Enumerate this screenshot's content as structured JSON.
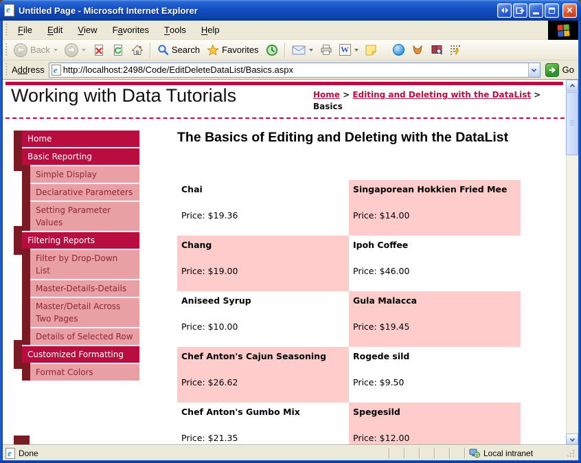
{
  "window": {
    "title": "Untitled Page - Microsoft Internet Explorer"
  },
  "menu": {
    "items": [
      {
        "label": "File",
        "accel": 0
      },
      {
        "label": "Edit",
        "accel": 0
      },
      {
        "label": "View",
        "accel": 0
      },
      {
        "label": "Favorites",
        "accel": 1
      },
      {
        "label": "Tools",
        "accel": 0
      },
      {
        "label": "Help",
        "accel": 0
      }
    ]
  },
  "toolbar": {
    "back_label": "Back",
    "search_label": "Search",
    "favorites_label": "Favorites"
  },
  "address": {
    "label_pre": "A",
    "label_accel": "dd",
    "label_rest": "ress",
    "url": "http://localhost:2498/Code/EditDeleteDataList/Basics.aspx",
    "go_label": "Go"
  },
  "page": {
    "site_title": "Working with Data Tutorials",
    "breadcrumb": {
      "separator": ">",
      "items": [
        {
          "label": "Home",
          "link": true
        },
        {
          "label": "Editing and Deleting with the DataList",
          "link": true
        },
        {
          "label": "Basics",
          "link": false
        }
      ]
    },
    "heading": "The Basics of Editing and Deleting with the DataList",
    "sidebar": [
      {
        "label": "Home",
        "level": 1
      },
      {
        "label": "Basic Reporting",
        "level": 1
      },
      {
        "label": "Simple Display",
        "level": 2
      },
      {
        "label": "Declarative Parameters",
        "level": 2
      },
      {
        "label": "Setting Parameter Values",
        "level": 2
      },
      {
        "label": "Filtering Reports",
        "level": 1
      },
      {
        "label": "Filter by Drop-Down List",
        "level": 2
      },
      {
        "label": "Master-Details-Details",
        "level": 2
      },
      {
        "label": "Master/Detail Across Two Pages",
        "level": 2
      },
      {
        "label": "Details of Selected Row",
        "level": 2
      },
      {
        "label": "Customized Formatting",
        "level": 1
      },
      {
        "label": "Format Colors",
        "level": 2
      }
    ],
    "products": {
      "price_prefix": "Price:",
      "items": [
        {
          "name": "Chai",
          "price": "$19.36",
          "highlight": false
        },
        {
          "name": "Singaporean Hokkien Fried Mee",
          "price": "$14.00",
          "highlight": true
        },
        {
          "name": "Chang",
          "price": "$19.00",
          "highlight": true
        },
        {
          "name": "Ipoh Coffee",
          "price": "$46.00",
          "highlight": false
        },
        {
          "name": "Aniseed Syrup",
          "price": "$10.00",
          "highlight": false
        },
        {
          "name": "Gula Malacca",
          "price": "$19.45",
          "highlight": true
        },
        {
          "name": "Chef Anton's Cajun Seasoning",
          "price": "$26.62",
          "highlight": true
        },
        {
          "name": "Rogede sild",
          "price": "$9.50",
          "highlight": false
        },
        {
          "name": "Chef Anton's Gumbo Mix",
          "price": "$21.35",
          "highlight": false
        },
        {
          "name": "Spegesild",
          "price": "$12.00",
          "highlight": true
        }
      ]
    }
  },
  "status": {
    "left": "Done",
    "zone": "Local intranet"
  },
  "colors": {
    "crimson": "#B90D40",
    "strip": "#7B1A22",
    "pink": "#E8A0A5",
    "l2text": "#8E2535",
    "cellpink": "#FFCCCC"
  }
}
